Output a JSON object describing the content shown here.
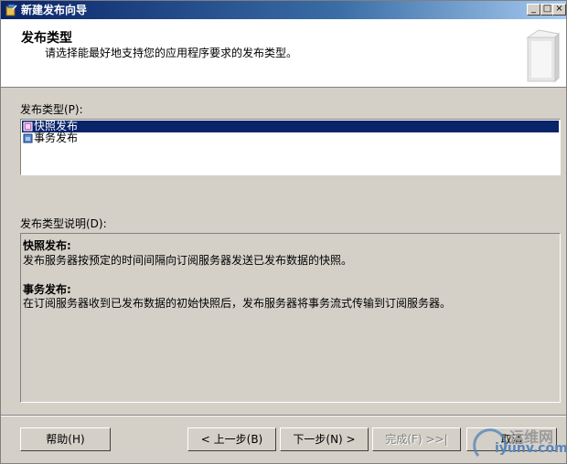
{
  "window": {
    "title": "新建发布向导"
  },
  "titlebar_buttons": {
    "minimize": "_",
    "maximize": "□",
    "close": "×"
  },
  "header": {
    "title": "发布类型",
    "subtitle": "请选择能最好地支持您的应用程序要求的发布类型。"
  },
  "publication_types": {
    "label": "发布类型(P):",
    "items": [
      {
        "label": "快照发布",
        "selected": true
      },
      {
        "label": "事务发布",
        "selected": false
      }
    ]
  },
  "description": {
    "label": "发布类型说明(D):",
    "sections": [
      {
        "heading": "快照发布:",
        "text": "发布服务器按预定的时间间隔向订阅服务器发送已发布数据的快照。"
      },
      {
        "heading": "事务发布:",
        "text": "在订阅服务器收到已发布数据的初始快照后，发布服务器将事务流式传输到订阅服务器。"
      }
    ]
  },
  "buttons": {
    "help": "帮助(H)",
    "back": "< 上一步(B)",
    "next": "下一步(N) >",
    "finish": "完成(F) >>|",
    "cancel": "取消"
  },
  "watermark": {
    "top": "运维网",
    "bottom": "iyunv.com"
  },
  "colors": {
    "selection": "#0a246a",
    "titlebar": "#0a246a",
    "face": "#d4d0c8"
  }
}
